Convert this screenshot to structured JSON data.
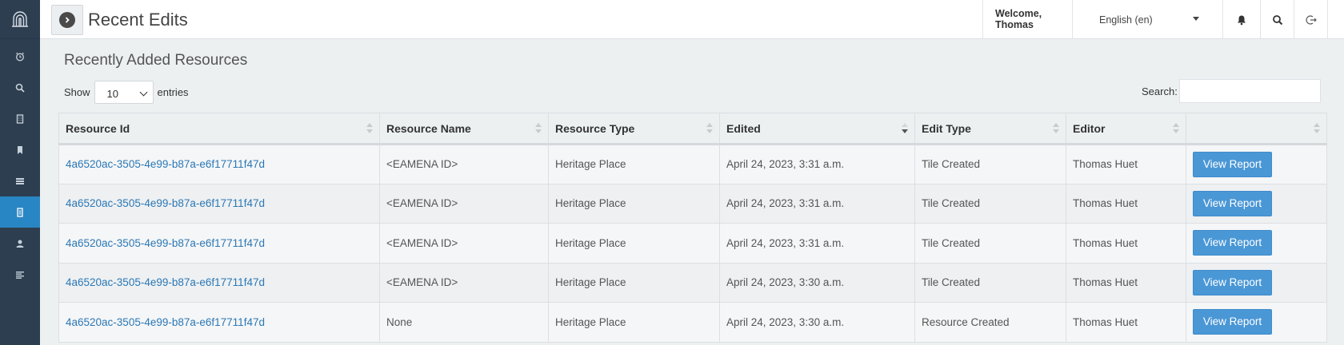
{
  "header": {
    "title": "Recent Edits",
    "welcome": "Welcome, Thomas",
    "language": "English (en)"
  },
  "sidebar": {
    "items": [
      {
        "icon": "clock-icon",
        "active": false
      },
      {
        "icon": "search-icon",
        "active": false
      },
      {
        "icon": "building-icon",
        "active": false
      },
      {
        "icon": "bookmark-icon",
        "active": false
      },
      {
        "icon": "list-icon",
        "active": false
      },
      {
        "icon": "report-icon",
        "active": true
      },
      {
        "icon": "user-icon",
        "active": false
      },
      {
        "icon": "align-left-icon",
        "active": false
      }
    ]
  },
  "main": {
    "section_title": "Recently Added Resources",
    "show_label": "Show",
    "entries_value": "10",
    "entries_label": "entries",
    "search_label": "Search:",
    "search_value": ""
  },
  "table": {
    "columns": [
      "Resource Id",
      "Resource Name",
      "Resource Type",
      "Edited",
      "Edit Type",
      "Editor",
      ""
    ],
    "rows": [
      {
        "id": "4a6520ac-3505-4e99-b87a-e6f17711f47d",
        "name": "<EAMENA ID>",
        "type": "Heritage Place",
        "edited": "April 24, 2023, 3:31 a.m.",
        "edit_type": "Tile Created",
        "editor": "Thomas Huet",
        "action": "View Report"
      },
      {
        "id": "4a6520ac-3505-4e99-b87a-e6f17711f47d",
        "name": "<EAMENA ID>",
        "type": "Heritage Place",
        "edited": "April 24, 2023, 3:31 a.m.",
        "edit_type": "Tile Created",
        "editor": "Thomas Huet",
        "action": "View Report"
      },
      {
        "id": "4a6520ac-3505-4e99-b87a-e6f17711f47d",
        "name": "<EAMENA ID>",
        "type": "Heritage Place",
        "edited": "April 24, 2023, 3:31 a.m.",
        "edit_type": "Tile Created",
        "editor": "Thomas Huet",
        "action": "View Report"
      },
      {
        "id": "4a6520ac-3505-4e99-b87a-e6f17711f47d",
        "name": "<EAMENA ID>",
        "type": "Heritage Place",
        "edited": "April 24, 2023, 3:30 a.m.",
        "edit_type": "Tile Created",
        "editor": "Thomas Huet",
        "action": "View Report"
      },
      {
        "id": "4a6520ac-3505-4e99-b87a-e6f17711f47d",
        "name": "None",
        "type": "Heritage Place",
        "edited": "April 24, 2023, 3:30 a.m.",
        "edit_type": "Resource Created",
        "editor": "Thomas Huet",
        "action": "View Report"
      }
    ]
  },
  "colors": {
    "sidebar_bg": "#2d3e50",
    "active_item": "#2986c4",
    "button": "#4a97d6",
    "link": "#2b78b5"
  }
}
